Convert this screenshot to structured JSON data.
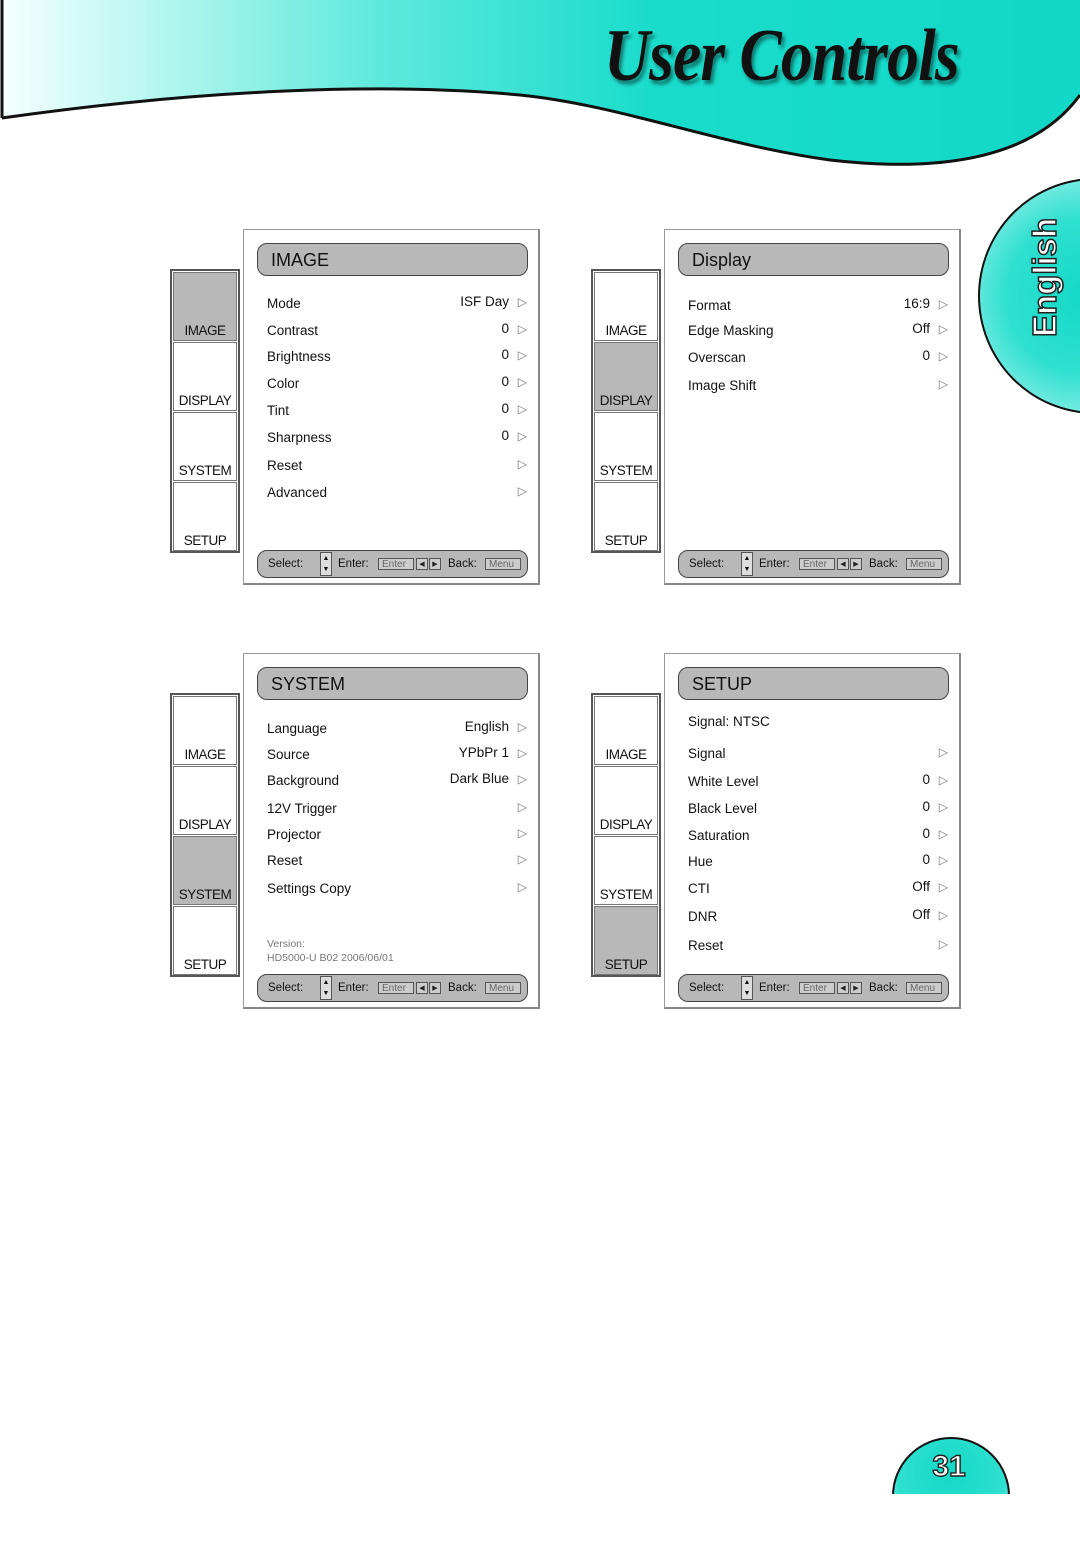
{
  "page": {
    "title": "User Controls",
    "language_tab": "English",
    "page_number": "31",
    "accent_color": "#14d8c6"
  },
  "footer_hints": {
    "select": "Select:",
    "enter": "Enter:",
    "enter_key": "Enter",
    "back": "Back:",
    "menu_key": "Menu"
  },
  "side_tabs": [
    "IMAGE",
    "DISPLAY",
    "SYSTEM",
    "SETUP"
  ],
  "menus": {
    "image": {
      "title": "IMAGE",
      "active_tab": "IMAGE",
      "items": [
        {
          "label": "Mode",
          "value": "ISF Day"
        },
        {
          "label": "Contrast",
          "value": "0"
        },
        {
          "label": "Brightness",
          "value": "0"
        },
        {
          "label": "Color",
          "value": "0"
        },
        {
          "label": "Tint",
          "value": "0"
        },
        {
          "label": "Sharpness",
          "value": "0"
        },
        {
          "label": "Reset",
          "value": ""
        },
        {
          "label": "Advanced",
          "value": ""
        }
      ]
    },
    "display": {
      "title": "Display",
      "active_tab": "DISPLAY",
      "items": [
        {
          "label": "Format",
          "value": "16:9"
        },
        {
          "label": "Edge Masking",
          "value": "Off"
        },
        {
          "label": "Overscan",
          "value": "0"
        },
        {
          "label": "Image Shift",
          "value": ""
        }
      ]
    },
    "system": {
      "title": "SYSTEM",
      "active_tab": "SYSTEM",
      "items": [
        {
          "label": "Language",
          "value": "English"
        },
        {
          "label": "Source",
          "value": "YPbPr 1"
        },
        {
          "label": "Background",
          "value": "Dark Blue"
        },
        {
          "label": "12V Trigger",
          "value": ""
        },
        {
          "label": "Projector",
          "value": ""
        },
        {
          "label": "Reset",
          "value": ""
        },
        {
          "label": "Settings Copy",
          "value": ""
        }
      ],
      "version_label": "Version:",
      "version_value": "HD5000-U B02 2006/06/01"
    },
    "setup": {
      "title": "SETUP",
      "active_tab": "SETUP",
      "signal_info": "Signal: NTSC",
      "items": [
        {
          "label": "Signal",
          "value": ""
        },
        {
          "label": "White Level",
          "value": "0"
        },
        {
          "label": "Black Level",
          "value": "0"
        },
        {
          "label": "Saturation",
          "value": "0"
        },
        {
          "label": "Hue",
          "value": "0"
        },
        {
          "label": "CTI",
          "value": "Off"
        },
        {
          "label": "DNR",
          "value": "Off"
        },
        {
          "label": "Reset",
          "value": ""
        }
      ]
    }
  }
}
